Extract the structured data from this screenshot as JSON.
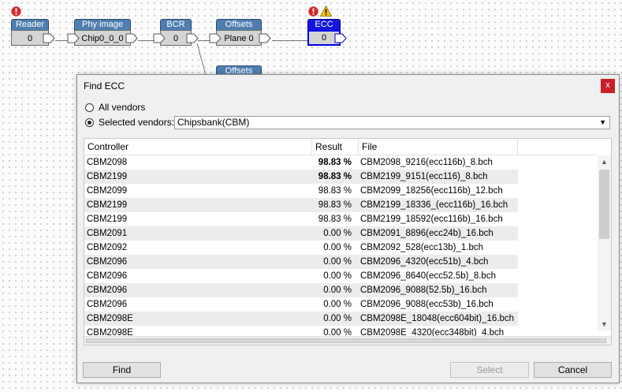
{
  "graph": {
    "nodes": [
      {
        "title": "Reader",
        "value": "0"
      },
      {
        "title": "Phy image",
        "value": "Chip0_0_0"
      },
      {
        "title": "BCR",
        "value": "0"
      },
      {
        "title": "Offsets",
        "value": "Plane 0"
      },
      {
        "title": "ECC",
        "value": "0"
      },
      {
        "title": "Offsets"
      }
    ]
  },
  "dialog": {
    "title": "Find ECC",
    "close_label": "x",
    "radio_all": "All vendors",
    "radio_selected": "Selected vendors:",
    "vendor_select": "Chipsbank(CBM)",
    "columns": [
      "Controller",
      "Result",
      "File"
    ],
    "rows": [
      {
        "controller": "CBM2098",
        "result": "98.83 %",
        "file": "CBM2098_9216(ecc116b)_8.bch"
      },
      {
        "controller": "CBM2199",
        "result": "98.83 %",
        "file": "CBM2199_9151(ecc116)_8.bch"
      },
      {
        "controller": "CBM2099",
        "result": "98.83 %",
        "file": "CBM2099_18256(ecc116b)_12.bch"
      },
      {
        "controller": "CBM2199",
        "result": "98.83 %",
        "file": "CBM2199_18336_(ecc116b)_16.bch"
      },
      {
        "controller": "CBM2199",
        "result": "98.83 %",
        "file": "CBM2199_18592(ecc116b)_16.bch"
      },
      {
        "controller": "CBM2091",
        "result": "0.00 %",
        "file": "CBM2091_8896(ecc24b)_16.bch"
      },
      {
        "controller": "CBM2092",
        "result": "0.00 %",
        "file": "CBM2092_528(ecc13b)_1.bch"
      },
      {
        "controller": "CBM2096",
        "result": "0.00 %",
        "file": "CBM2096_4320(ecc51b)_4.bch"
      },
      {
        "controller": "CBM2096",
        "result": "0.00 %",
        "file": "CBM2096_8640(ecc52.5b)_8.bch"
      },
      {
        "controller": "CBM2096",
        "result": "0.00 %",
        "file": "CBM2096_9088(52.5b)_16.bch"
      },
      {
        "controller": "CBM2096",
        "result": "0.00 %",
        "file": "CBM2096_9088(ecc53b)_16.bch"
      },
      {
        "controller": "CBM2098E",
        "result": "0.00 %",
        "file": "CBM2098E_18048(ecc604bit)_16.bch"
      },
      {
        "controller": "CBM2098E",
        "result": "0.00 %",
        "file": "CBM2098E_4320(ecc348bit)_4.bch"
      }
    ],
    "buttons": {
      "find": "Find",
      "select": "Select",
      "cancel": "Cancel"
    }
  },
  "icons": {
    "error": "error-icon",
    "warning": "warning-icon"
  },
  "colors": {
    "node_header": "#4f7fb0",
    "node_selected": "#1414e0",
    "close_button": "#c8202a"
  }
}
